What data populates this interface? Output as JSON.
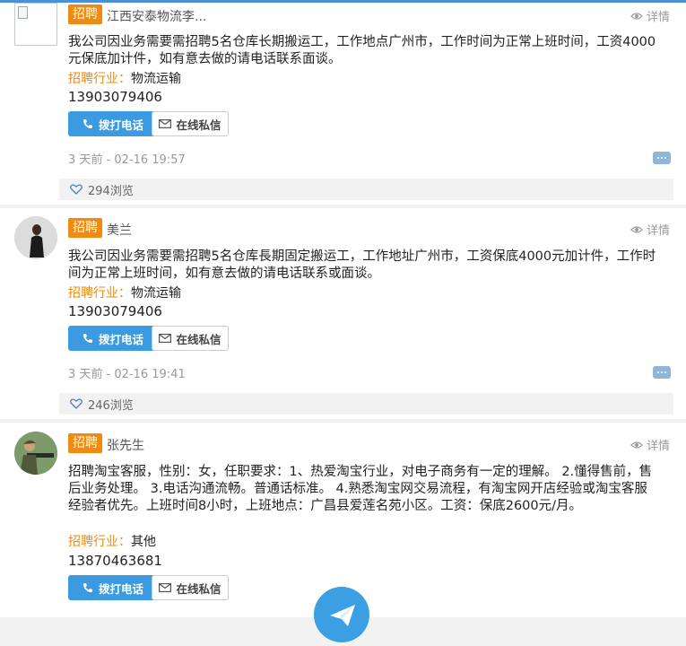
{
  "posts": [
    {
      "badge": "招聘",
      "name": "江西安泰物流李...",
      "detail": "详情",
      "description": "我公司因业务需要需招聘5名仓库长期搬运工，工作地点广州市，工作时间为正常上班时间，工资4000元保底加计件，如有意去做的请电话联系面谈。",
      "industry_label": "招聘行业：",
      "industry_value": "物流运输",
      "phone": "13903079406",
      "call_label": "拨打电话",
      "message_label": "在线私信",
      "time": "3 天前 - 02-16 19:57",
      "views": "294浏览"
    },
    {
      "badge": "招聘",
      "name": "美兰",
      "detail": "详情",
      "description": "我公司因业务需要需招聘5名仓库長期固定搬运工，工作地址广州市，工资保底4000元加计件，工作时间为正常上班时间，如有意去做的请电话联系或面谈。",
      "industry_label": "招聘行业：",
      "industry_value": "物流运输",
      "phone": "13903079406",
      "call_label": "拨打电话",
      "message_label": "在线私信",
      "time": "3 天前 - 02-16 19:41",
      "views": "246浏览"
    },
    {
      "badge": "招聘",
      "name": "张先生",
      "detail": "详情",
      "description": "招聘淘宝客服，性别：女，任职要求：1、热爱淘宝行业，对电子商务有一定的理解。 2.懂得售前，售后业务处理。 3.电话沟通流畅。普通话标准。 4.熟悉淘宝网交易流程，有淘宝网开店经验或淘宝客服经验者优先。上班时间8小时，上班地点：广昌县爱莲名苑小区。工资：保底2600元/月。",
      "industry_label": "招聘行业：",
      "industry_value": "其他",
      "phone": "13870463681",
      "call_label": "拨打电话",
      "message_label": "在线私信"
    }
  ],
  "colors": {
    "badge": "#f08a12",
    "primary_button": "#3c9be0",
    "page_bg": "#f2f2f2"
  },
  "icons": [
    "eye-icon",
    "phone-icon",
    "envelope-icon",
    "comment-icon",
    "heart-icon",
    "paper-plane-icon"
  ]
}
